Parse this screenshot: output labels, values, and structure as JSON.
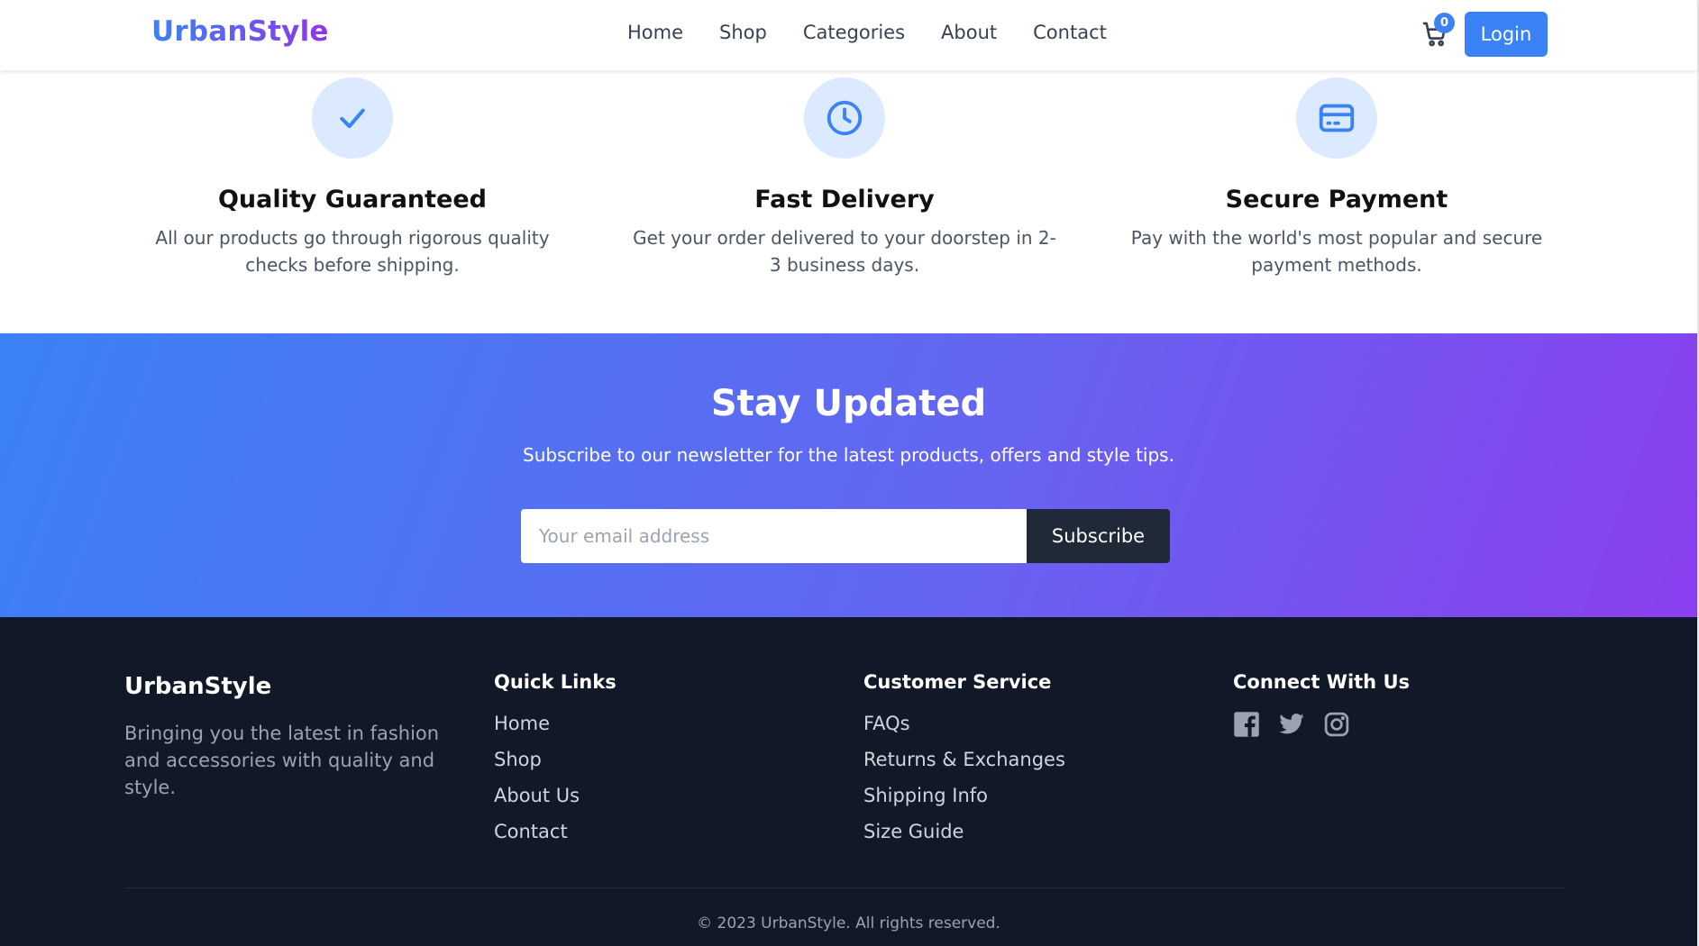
{
  "header": {
    "logo": "UrbanStyle",
    "nav": [
      "Home",
      "Shop",
      "Categories",
      "About",
      "Contact"
    ],
    "cart_count": "0",
    "login_label": "Login"
  },
  "features": [
    {
      "icon": "check-icon",
      "title": "Quality Guaranteed",
      "text": "All our products go through rigorous quality checks before shipping."
    },
    {
      "icon": "clock-icon",
      "title": "Fast Delivery",
      "text": "Get your order delivered to your doorstep in 2-3 business days."
    },
    {
      "icon": "credit-card-icon",
      "title": "Secure Payment",
      "text": "Pay with the world's most popular and secure payment methods."
    }
  ],
  "newsletter": {
    "title": "Stay Updated",
    "subtitle": "Subscribe to our newsletter for the latest products, offers and style tips.",
    "placeholder": "Your email address",
    "button": "Subscribe"
  },
  "footer": {
    "brand": "UrbanStyle",
    "description": "Bringing you the latest in fashion and accessories with quality and style.",
    "quick_links": {
      "title": "Quick Links",
      "items": [
        "Home",
        "Shop",
        "About Us",
        "Contact"
      ]
    },
    "customer_service": {
      "title": "Customer Service",
      "items": [
        "FAQs",
        "Returns & Exchanges",
        "Shipping Info",
        "Size Guide"
      ]
    },
    "connect": {
      "title": "Connect With Us",
      "icons": [
        "facebook-icon",
        "twitter-icon",
        "instagram-icon"
      ]
    },
    "copyright": "© 2023 UrbanStyle. All rights reserved."
  },
  "colors": {
    "accent": "#3b82f6",
    "gradient_end": "#8b3ff0",
    "footer_bg": "#111827",
    "icon_bg": "#dbeafe"
  }
}
